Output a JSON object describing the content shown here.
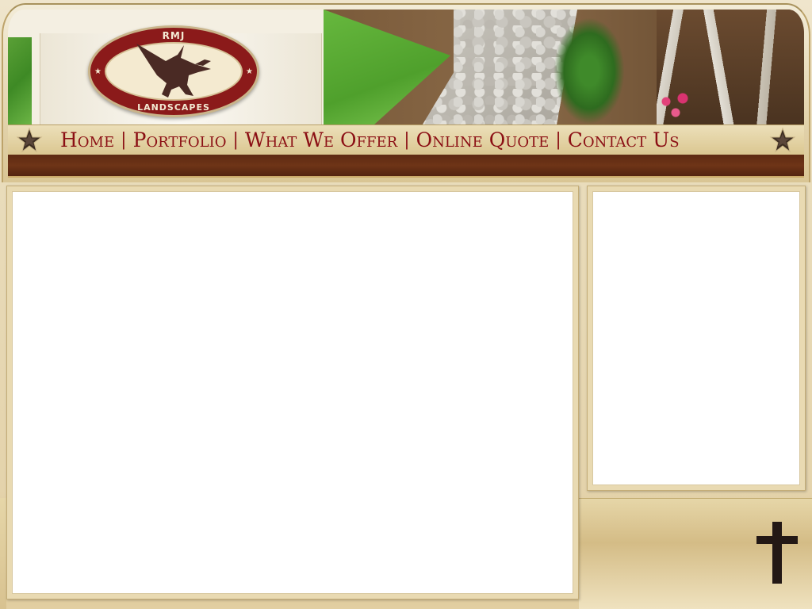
{
  "logo": {
    "top_text": "RMJ",
    "bottom_text": "LANDSCAPES",
    "icon": "heron-icon"
  },
  "nav": {
    "items": [
      {
        "label": "Home"
      },
      {
        "label": "Portfolio"
      },
      {
        "label": "What We Offer"
      },
      {
        "label": "Online Quote"
      },
      {
        "label": "Contact Us"
      }
    ],
    "separator": "|",
    "star_icon": "star-icon"
  },
  "colors": {
    "nav_text": "#8b0f14",
    "brown_band": "#6e3417",
    "logo_red": "#8b1a1a",
    "panel_bg": "#e9dab2"
  },
  "footer": {
    "icon": "cross-icon"
  }
}
